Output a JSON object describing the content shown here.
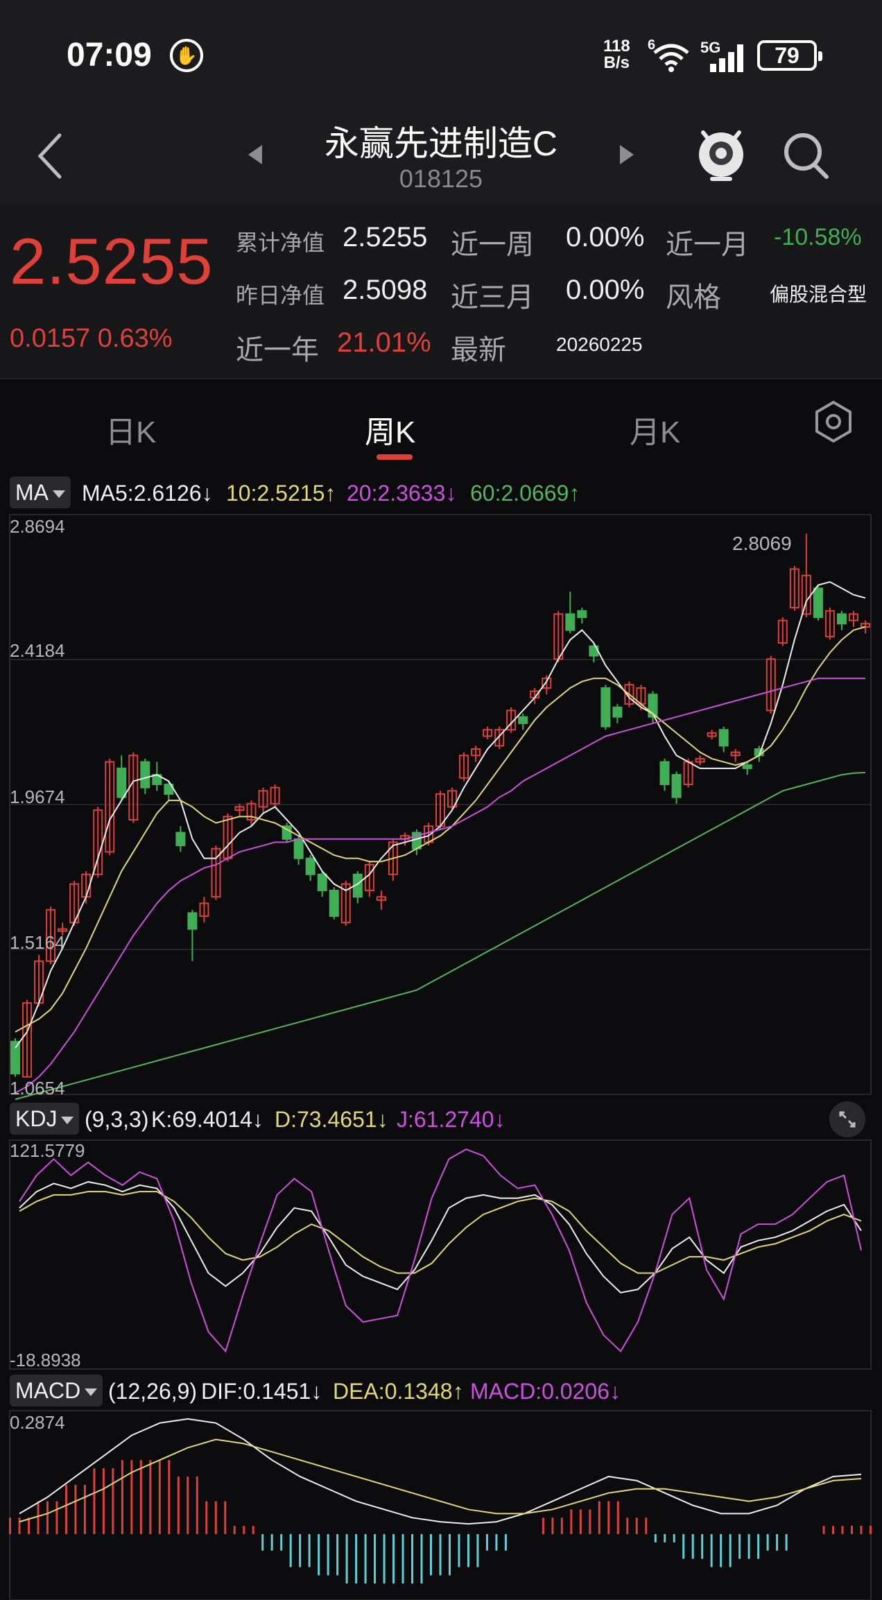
{
  "status": {
    "time": "07:09",
    "net_speed_value": "118",
    "net_speed_unit": "B/s",
    "network": "5G",
    "wifi_badge": "6",
    "battery": "79"
  },
  "nav": {
    "title": "永赢先进制造C",
    "code": "018125"
  },
  "quote": {
    "price": "2.5255",
    "change": "0.0157",
    "change_pct": "0.63%",
    "cum_nav_label": "累计净值",
    "cum_nav": "2.5255",
    "prev_nav_label": "昨日净值",
    "prev_nav": "2.5098",
    "year_label": "近一年",
    "year_value": "21.01%",
    "week_label": "近一周",
    "week_value": "0.00%",
    "quarter_label": "近三月",
    "quarter_value": "0.00%",
    "latest_label": "最新",
    "latest_value": "20260225",
    "month_label": "近一月",
    "month_value": "-10.58%",
    "style_label": "风格",
    "style_value": "偏股混合型"
  },
  "tabs": {
    "day": "日K",
    "week": "周K",
    "month": "月K"
  },
  "ma": {
    "btn": "MA",
    "ma5": "MA5:2.6126↓",
    "ma10": "10:2.5215↑",
    "ma20": "20:2.3633↓",
    "ma60": "60:2.0669↑",
    "axis": [
      "2.8694",
      "2.4184",
      "1.9674",
      "1.5164",
      "1.0654"
    ],
    "peak_label": "2.8069"
  },
  "kdj": {
    "btn": "KDJ",
    "params": "(9,3,3)",
    "k": "K:69.4014↓",
    "d": "D:73.4651↓",
    "j": "J:61.2740↓",
    "axis_top": "121.5779",
    "axis_bottom": "-18.8938"
  },
  "macd": {
    "btn": "MACD",
    "params": "(12,26,9)",
    "dif": "DIF:0.1451↓",
    "dea": "DEA:0.1348↑",
    "macd": "MACD:0.0206↓",
    "axis_top": "0.2874"
  },
  "chart_data": [
    {
      "type": "candlestick",
      "ylim": [
        1.0654,
        2.8694
      ],
      "y_ticks": [
        2.8694,
        2.4184,
        1.9674,
        1.5164,
        1.0654
      ],
      "annotations": [
        "2.8069"
      ],
      "candles": [
        [
          1.23,
          1.13,
          1.24,
          1.12
        ],
        [
          1.12,
          1.35,
          1.36,
          1.12
        ],
        [
          1.35,
          1.48,
          1.5,
          1.34
        ],
        [
          1.48,
          1.64,
          1.65,
          1.47
        ],
        [
          1.58,
          1.58,
          1.6,
          1.56
        ],
        [
          1.6,
          1.72,
          1.73,
          1.59
        ],
        [
          1.68,
          1.75,
          1.76,
          1.66
        ],
        [
          1.75,
          1.95,
          1.96,
          1.74
        ],
        [
          1.82,
          2.1,
          2.11,
          1.81
        ],
        [
          2.08,
          1.99,
          2.12,
          1.98
        ],
        [
          1.92,
          2.12,
          2.13,
          1.91
        ],
        [
          2.1,
          2.02,
          2.11,
          2.0
        ],
        [
          2.06,
          2.03,
          2.1,
          2.01
        ],
        [
          2.03,
          2.0,
          2.04,
          1.98
        ],
        [
          1.88,
          1.84,
          1.9,
          1.82
        ],
        [
          1.63,
          1.58,
          1.64,
          1.48
        ],
        [
          1.62,
          1.66,
          1.68,
          1.6
        ],
        [
          1.68,
          1.83,
          1.84,
          1.67
        ],
        [
          1.8,
          1.93,
          1.94,
          1.79
        ],
        [
          1.95,
          1.96,
          1.97,
          1.93
        ],
        [
          1.92,
          1.97,
          1.98,
          1.9
        ],
        [
          1.96,
          2.01,
          2.02,
          1.94
        ],
        [
          1.97,
          2.02,
          2.03,
          1.96
        ],
        [
          1.9,
          1.86,
          1.91,
          1.85
        ],
        [
          1.86,
          1.8,
          1.87,
          1.78
        ],
        [
          1.8,
          1.75,
          1.81,
          1.73
        ],
        [
          1.75,
          1.7,
          1.76,
          1.68
        ],
        [
          1.7,
          1.62,
          1.71,
          1.61
        ],
        [
          1.6,
          1.72,
          1.73,
          1.59
        ],
        [
          1.75,
          1.68,
          1.76,
          1.66
        ],
        [
          1.7,
          1.78,
          1.79,
          1.68
        ],
        [
          1.67,
          1.68,
          1.7,
          1.64
        ],
        [
          1.75,
          1.85,
          1.86,
          1.73
        ],
        [
          1.86,
          1.87,
          1.88,
          1.84
        ],
        [
          1.88,
          1.83,
          1.89,
          1.81
        ],
        [
          1.85,
          1.9,
          1.91,
          1.84
        ],
        [
          1.9,
          2.0,
          2.01,
          1.89
        ],
        [
          1.96,
          2.01,
          2.02,
          1.95
        ],
        [
          2.05,
          2.12,
          2.13,
          2.04
        ],
        [
          2.12,
          2.14,
          2.15,
          2.1
        ],
        [
          2.18,
          2.2,
          2.21,
          2.17
        ],
        [
          2.15,
          2.2,
          2.21,
          2.14
        ],
        [
          2.2,
          2.26,
          2.27,
          2.19
        ],
        [
          2.24,
          2.22,
          2.25,
          2.2
        ],
        [
          2.3,
          2.32,
          2.33,
          2.28
        ],
        [
          2.33,
          2.36,
          2.37,
          2.31
        ],
        [
          2.42,
          2.56,
          2.57,
          2.41
        ],
        [
          2.56,
          2.51,
          2.63,
          2.5
        ],
        [
          2.57,
          2.55,
          2.58,
          2.53
        ],
        [
          2.46,
          2.43,
          2.47,
          2.41
        ],
        [
          2.33,
          2.21,
          2.34,
          2.2
        ],
        [
          2.27,
          2.24,
          2.28,
          2.22
        ],
        [
          2.28,
          2.34,
          2.35,
          2.27
        ],
        [
          2.28,
          2.33,
          2.34,
          2.26
        ],
        [
          2.31,
          2.24,
          2.32,
          2.22
        ],
        [
          2.1,
          2.03,
          2.11,
          2.01
        ],
        [
          2.06,
          1.99,
          2.07,
          1.97
        ],
        [
          2.03,
          2.1,
          2.11,
          2.02
        ],
        [
          2.1,
          2.11,
          2.12,
          2.09
        ],
        [
          2.18,
          2.19,
          2.2,
          2.17
        ],
        [
          2.2,
          2.15,
          2.21,
          2.13
        ],
        [
          2.12,
          2.13,
          2.14,
          2.1
        ],
        [
          2.09,
          2.08,
          2.1,
          2.06
        ],
        [
          2.14,
          2.12,
          2.15,
          2.1
        ],
        [
          2.26,
          2.42,
          2.43,
          2.25
        ],
        [
          2.47,
          2.54,
          2.55,
          2.46
        ],
        [
          2.58,
          2.7,
          2.71,
          2.57
        ],
        [
          2.56,
          2.68,
          2.81,
          2.55
        ],
        [
          2.64,
          2.55,
          2.65,
          2.54
        ],
        [
          2.49,
          2.57,
          2.58,
          2.48
        ],
        [
          2.56,
          2.53,
          2.57,
          2.51
        ],
        [
          2.54,
          2.56,
          2.57,
          2.52
        ],
        [
          2.52,
          2.53,
          2.54,
          2.5
        ]
      ],
      "series": [
        {
          "name": "MA5",
          "values": [
            1.21,
            1.26,
            1.35,
            1.45,
            1.52,
            1.6,
            1.68,
            1.8,
            1.92,
            1.98,
            2.04,
            2.05,
            2.06,
            2.04,
            1.98,
            1.86,
            1.8,
            1.8,
            1.84,
            1.88,
            1.9,
            1.94,
            1.96,
            1.92,
            1.88,
            1.82,
            1.76,
            1.72,
            1.7,
            1.72,
            1.75,
            1.8,
            1.84,
            1.85,
            1.86,
            1.87,
            1.9,
            1.95,
            2.02,
            2.08,
            2.14,
            2.18,
            2.22,
            2.26,
            2.3,
            2.35,
            2.42,
            2.48,
            2.51,
            2.47,
            2.4,
            2.35,
            2.3,
            2.27,
            2.25,
            2.18,
            2.12,
            2.1,
            2.08,
            2.08,
            2.08,
            2.08,
            2.1,
            2.12,
            2.22,
            2.34,
            2.48,
            2.6,
            2.65,
            2.66,
            2.64,
            2.62,
            2.61
          ]
        },
        {
          "name": "MA10",
          "values": [
            1.26,
            1.28,
            1.3,
            1.33,
            1.38,
            1.45,
            1.52,
            1.6,
            1.68,
            1.76,
            1.82,
            1.88,
            1.94,
            1.98,
            1.98,
            1.96,
            1.93,
            1.91,
            1.92,
            1.93,
            1.93,
            1.92,
            1.91,
            1.89,
            1.87,
            1.85,
            1.83,
            1.81,
            1.8,
            1.8,
            1.79,
            1.79,
            1.8,
            1.81,
            1.83,
            1.85,
            1.87,
            1.9,
            1.94,
            1.98,
            2.03,
            2.08,
            2.13,
            2.18,
            2.23,
            2.27,
            2.3,
            2.33,
            2.35,
            2.36,
            2.36,
            2.34,
            2.31,
            2.28,
            2.25,
            2.22,
            2.19,
            2.16,
            2.13,
            2.11,
            2.1,
            2.09,
            2.1,
            2.12,
            2.15,
            2.2,
            2.26,
            2.33,
            2.39,
            2.44,
            2.48,
            2.51,
            2.52
          ]
        },
        {
          "name": "MA20",
          "values": [
            1.07,
            1.09,
            1.12,
            1.16,
            1.21,
            1.26,
            1.32,
            1.38,
            1.44,
            1.5,
            1.56,
            1.61,
            1.66,
            1.7,
            1.73,
            1.75,
            1.77,
            1.78,
            1.8,
            1.82,
            1.83,
            1.84,
            1.85,
            1.85,
            1.86,
            1.86,
            1.86,
            1.86,
            1.86,
            1.86,
            1.86,
            1.86,
            1.86,
            1.86,
            1.87,
            1.88,
            1.89,
            1.9,
            1.92,
            1.94,
            1.96,
            1.99,
            2.01,
            2.04,
            2.06,
            2.08,
            2.1,
            2.12,
            2.14,
            2.16,
            2.18,
            2.19,
            2.2,
            2.21,
            2.22,
            2.23,
            2.24,
            2.25,
            2.26,
            2.27,
            2.28,
            2.29,
            2.3,
            2.31,
            2.32,
            2.33,
            2.34,
            2.35,
            2.36,
            2.36,
            2.36,
            2.36,
            2.36
          ]
        },
        {
          "name": "MA60",
          "values": [
            1.05,
            1.06,
            1.07,
            1.08,
            1.09,
            1.1,
            1.11,
            1.12,
            1.13,
            1.14,
            1.15,
            1.16,
            1.17,
            1.18,
            1.19,
            1.2,
            1.21,
            1.22,
            1.23,
            1.24,
            1.25,
            1.26,
            1.27,
            1.28,
            1.29,
            1.3,
            1.31,
            1.32,
            1.33,
            1.34,
            1.35,
            1.36,
            1.37,
            1.38,
            1.39,
            1.41,
            1.43,
            1.45,
            1.47,
            1.49,
            1.51,
            1.53,
            1.55,
            1.57,
            1.59,
            1.61,
            1.63,
            1.65,
            1.67,
            1.69,
            1.71,
            1.73,
            1.75,
            1.77,
            1.79,
            1.81,
            1.83,
            1.85,
            1.87,
            1.89,
            1.91,
            1.93,
            1.95,
            1.97,
            1.99,
            2.01,
            2.02,
            2.03,
            2.04,
            2.05,
            2.06,
            2.065,
            2.0669
          ]
        }
      ]
    },
    {
      "type": "line",
      "title": "KDJ",
      "ylim": [
        -18.8938,
        121.5779
      ],
      "series": [
        {
          "name": "K",
          "values": [
            80,
            90,
            95,
            92,
            96,
            94,
            90,
            94,
            92,
            80,
            60,
            40,
            32,
            40,
            52,
            68,
            80,
            78,
            62,
            45,
            38,
            34,
            30,
            42,
            60,
            80,
            86,
            88,
            86,
            86,
            88,
            82,
            70,
            52,
            38,
            28,
            30,
            40,
            55,
            62,
            48,
            40,
            56,
            60,
            62,
            66,
            72,
            78,
            82,
            66
          ]
        },
        {
          "name": "D",
          "values": [
            78,
            84,
            88,
            88,
            90,
            90,
            88,
            90,
            90,
            84,
            74,
            62,
            52,
            48,
            50,
            56,
            64,
            70,
            66,
            58,
            50,
            44,
            40,
            40,
            46,
            58,
            68,
            76,
            80,
            84,
            86,
            84,
            78,
            66,
            56,
            46,
            40,
            40,
            45,
            50,
            50,
            48,
            52,
            56,
            58,
            62,
            66,
            72,
            76,
            72
          ]
        },
        {
          "name": "J",
          "values": [
            84,
            100,
            110,
            100,
            108,
            100,
            94,
            102,
            98,
            72,
            34,
            4,
            -8,
            26,
            58,
            88,
            98,
            90,
            54,
            20,
            10,
            12,
            14,
            48,
            86,
            110,
            116,
            112,
            100,
            92,
            94,
            76,
            54,
            22,
            2,
            -8,
            10,
            40,
            76,
            86,
            42,
            24,
            64,
            70,
            70,
            76,
            86,
            96,
            100,
            54
          ]
        }
      ]
    },
    {
      "type": "line",
      "title": "MACD",
      "series": [
        {
          "name": "DIF",
          "values": [
            0.05,
            0.09,
            0.14,
            0.19,
            0.24,
            0.27,
            0.28,
            0.27,
            0.23,
            0.18,
            0.14,
            0.11,
            0.08,
            0.06,
            0.04,
            0.03,
            0.025,
            0.03,
            0.05,
            0.08,
            0.11,
            0.14,
            0.13,
            0.1,
            0.07,
            0.05,
            0.05,
            0.07,
            0.11,
            0.14,
            0.1451
          ]
        },
        {
          "name": "DEA",
          "values": [
            0.03,
            0.05,
            0.08,
            0.11,
            0.15,
            0.18,
            0.21,
            0.23,
            0.22,
            0.2,
            0.18,
            0.16,
            0.14,
            0.12,
            0.1,
            0.08,
            0.06,
            0.05,
            0.05,
            0.06,
            0.08,
            0.1,
            0.11,
            0.11,
            0.1,
            0.09,
            0.08,
            0.09,
            0.11,
            0.13,
            0.1348
          ]
        },
        {
          "name": "MACD",
          "values": [
            0.04,
            0.08,
            0.12,
            0.16,
            0.18,
            0.18,
            0.14,
            0.08,
            0.02,
            -0.04,
            -0.08,
            -0.1,
            -0.12,
            -0.12,
            -0.12,
            -0.1,
            -0.08,
            -0.04,
            0.0,
            0.04,
            0.06,
            0.08,
            0.04,
            -0.02,
            -0.06,
            -0.08,
            -0.06,
            -0.04,
            0.0,
            0.02,
            0.0206
          ]
        }
      ]
    }
  ]
}
